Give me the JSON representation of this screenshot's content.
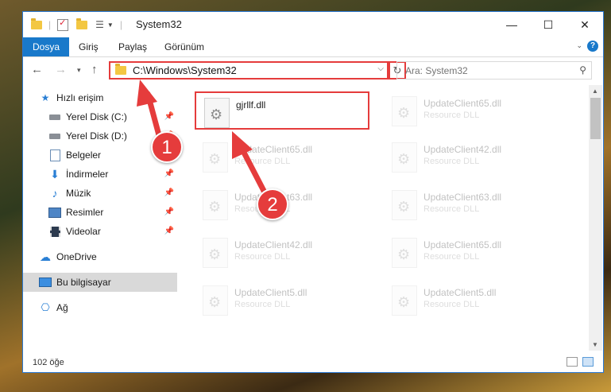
{
  "window": {
    "title": "System32",
    "controls": {
      "minimize": "—",
      "maximize": "☐",
      "close": "✕"
    }
  },
  "ribbon": {
    "tabs": [
      {
        "label": "Dosya",
        "active": true
      },
      {
        "label": "Giriş",
        "active": false
      },
      {
        "label": "Paylaş",
        "active": false
      },
      {
        "label": "Görünüm",
        "active": false
      }
    ],
    "help": "?"
  },
  "nav": {
    "address": "C:\\Windows\\System32",
    "search_placeholder": "Ara: System32"
  },
  "sidebar": {
    "items": [
      {
        "label": "Hızlı erişim",
        "icon": "star-icon",
        "pinned": false,
        "selected": false
      },
      {
        "label": "Yerel Disk (C:)",
        "icon": "drive-icon",
        "pinned": true,
        "selected": false
      },
      {
        "label": "Yerel Disk (D:)",
        "icon": "drive-icon",
        "pinned": true,
        "selected": false
      },
      {
        "label": "Belgeler",
        "icon": "documents-icon",
        "pinned": true,
        "selected": false
      },
      {
        "label": "İndirmeler",
        "icon": "download-icon",
        "pinned": true,
        "selected": false
      },
      {
        "label": "Müzik",
        "icon": "music-icon",
        "pinned": true,
        "selected": false
      },
      {
        "label": "Resimler",
        "icon": "pictures-icon",
        "pinned": true,
        "selected": false
      },
      {
        "label": "Videolar",
        "icon": "video-icon",
        "pinned": true,
        "selected": false
      },
      {
        "label": "OneDrive",
        "icon": "cloud-icon",
        "pinned": false,
        "selected": false
      },
      {
        "label": "Bu bilgisayar",
        "icon": "computer-icon",
        "pinned": false,
        "selected": true
      },
      {
        "label": "Ağ",
        "icon": "network-icon",
        "pinned": false,
        "selected": false
      }
    ]
  },
  "files": [
    {
      "name": "gjrllf.dll",
      "type": "",
      "highlight": true
    },
    {
      "name": "UpdateClient65.dll",
      "type": "Resource DLL",
      "highlight": false
    },
    {
      "name": "UpdateClient65.dll",
      "type": "Resource DLL",
      "highlight": false
    },
    {
      "name": "UpdateClient42.dll",
      "type": "Resource DLL",
      "highlight": false
    },
    {
      "name": "UpdateClient63.dll",
      "type": "Resource DLL",
      "highlight": false
    },
    {
      "name": "UpdateClient63.dll",
      "type": "Resource DLL",
      "highlight": false
    },
    {
      "name": "UpdateClient42.dll",
      "type": "Resource DLL",
      "highlight": false
    },
    {
      "name": "UpdateClient65.dll",
      "type": "Resource DLL",
      "highlight": false
    },
    {
      "name": "UpdateClient5.dll",
      "type": "Resource DLL",
      "highlight": false
    },
    {
      "name": "UpdateClient5.dll",
      "type": "Resource DLL",
      "highlight": false
    }
  ],
  "status": {
    "count": "102 öğe"
  },
  "annotations": {
    "step1": "1",
    "step2": "2"
  },
  "colors": {
    "accent": "#1979ca",
    "annotation": "#e53c3c"
  }
}
